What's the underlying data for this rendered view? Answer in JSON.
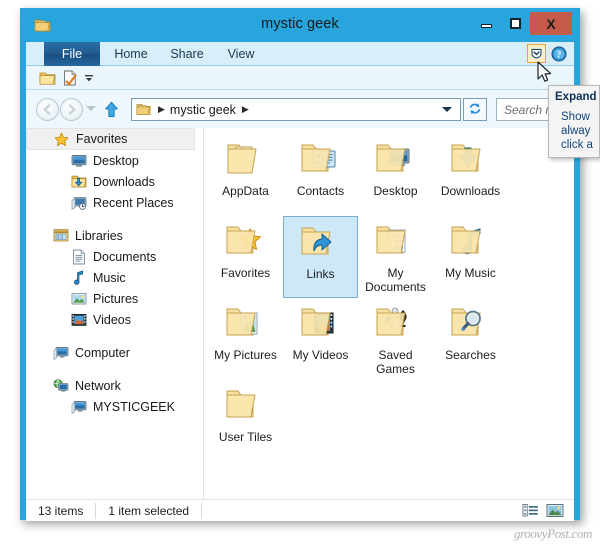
{
  "window": {
    "title": "mystic geek",
    "title_icon": "user-folder-icon",
    "buttons": {
      "minimize": "minimize-icon",
      "maximize": "maximize-icon",
      "close": "X"
    }
  },
  "ribbon": {
    "tabs": [
      {
        "id": "file",
        "label": "File",
        "active": true
      },
      {
        "id": "home",
        "label": "Home",
        "active": false
      },
      {
        "id": "share",
        "label": "Share",
        "active": false
      },
      {
        "id": "view",
        "label": "View",
        "active": false
      }
    ],
    "expand_button": "expand-ribbon-icon",
    "help_button": "help-icon"
  },
  "quick_access": {
    "items": [
      {
        "icon": "folder-icon"
      },
      {
        "icon": "properties-icon"
      },
      {
        "icon": "customize-dropdown-icon"
      }
    ]
  },
  "address_bar": {
    "back": "back-arrow-icon",
    "forward": "forward-arrow-icon",
    "history": "history-dropdown-icon",
    "up": "up-arrow-icon",
    "path_icon": "user-folder-icon",
    "crumb": "mystic geek",
    "dropdown": "path-dropdown-icon",
    "refresh": "refresh-icon"
  },
  "search": {
    "placeholder": "Search my..."
  },
  "sidebar": {
    "groups": [
      {
        "root": {
          "label": "Favorites",
          "icon": "star-icon",
          "highlighted": true
        },
        "children": [
          {
            "label": "Desktop",
            "icon": "desktop-icon"
          },
          {
            "label": "Downloads",
            "icon": "downloads-icon"
          },
          {
            "label": "Recent Places",
            "icon": "recent-places-icon"
          }
        ]
      },
      {
        "root": {
          "label": "Libraries",
          "icon": "libraries-icon",
          "highlighted": false
        },
        "children": [
          {
            "label": "Documents",
            "icon": "document-icon"
          },
          {
            "label": "Music",
            "icon": "music-note-icon"
          },
          {
            "label": "Pictures",
            "icon": "picture-icon"
          },
          {
            "label": "Videos",
            "icon": "video-icon"
          }
        ]
      },
      {
        "root": {
          "label": "Computer",
          "icon": "computer-icon",
          "highlighted": false
        },
        "children": []
      },
      {
        "root": {
          "label": "Network",
          "icon": "network-icon",
          "highlighted": false
        },
        "children": [
          {
            "label": "MYSTICGEEK",
            "icon": "computer-icon"
          }
        ]
      }
    ]
  },
  "files": [
    {
      "name": "AppData",
      "icon": "folder-appdata-icon",
      "selected": false
    },
    {
      "name": "Contacts",
      "icon": "folder-contacts-icon",
      "selected": false
    },
    {
      "name": "Desktop",
      "icon": "folder-desktop-icon",
      "selected": false
    },
    {
      "name": "Downloads",
      "icon": "folder-downloads-icon",
      "selected": false
    },
    {
      "name": "Favorites",
      "icon": "folder-favorites-icon",
      "selected": false
    },
    {
      "name": "Links",
      "icon": "folder-links-icon",
      "selected": true
    },
    {
      "name": "My Documents",
      "icon": "folder-documents-icon",
      "selected": false
    },
    {
      "name": "My Music",
      "icon": "folder-music-icon",
      "selected": false
    },
    {
      "name": "My Pictures",
      "icon": "folder-pictures-icon",
      "selected": false
    },
    {
      "name": "My Videos",
      "icon": "folder-videos-icon",
      "selected": false
    },
    {
      "name": "Saved Games",
      "icon": "folder-games-icon",
      "selected": false
    },
    {
      "name": "Searches",
      "icon": "folder-searches-icon",
      "selected": false
    },
    {
      "name": "User Tiles",
      "icon": "folder-open-icon",
      "selected": false
    }
  ],
  "status_bar": {
    "item_count": "13 items",
    "selection": "1 item selected",
    "view_details": "details-view-icon",
    "view_large_icons": "large-icons-view-icon"
  },
  "tooltip": {
    "title": "Expand",
    "line1": "Show",
    "line2": "alway",
    "line3": "click a"
  },
  "watermark": "groovyPost.com",
  "colors": {
    "frame_blue": "#29a5de",
    "ribbon_bg": "#d9eefb",
    "file_tab": "#1f5b8f",
    "close_red": "#c75b4b",
    "selection_blue": "#cde8f7",
    "expand_highlight": "#e8a33d"
  }
}
